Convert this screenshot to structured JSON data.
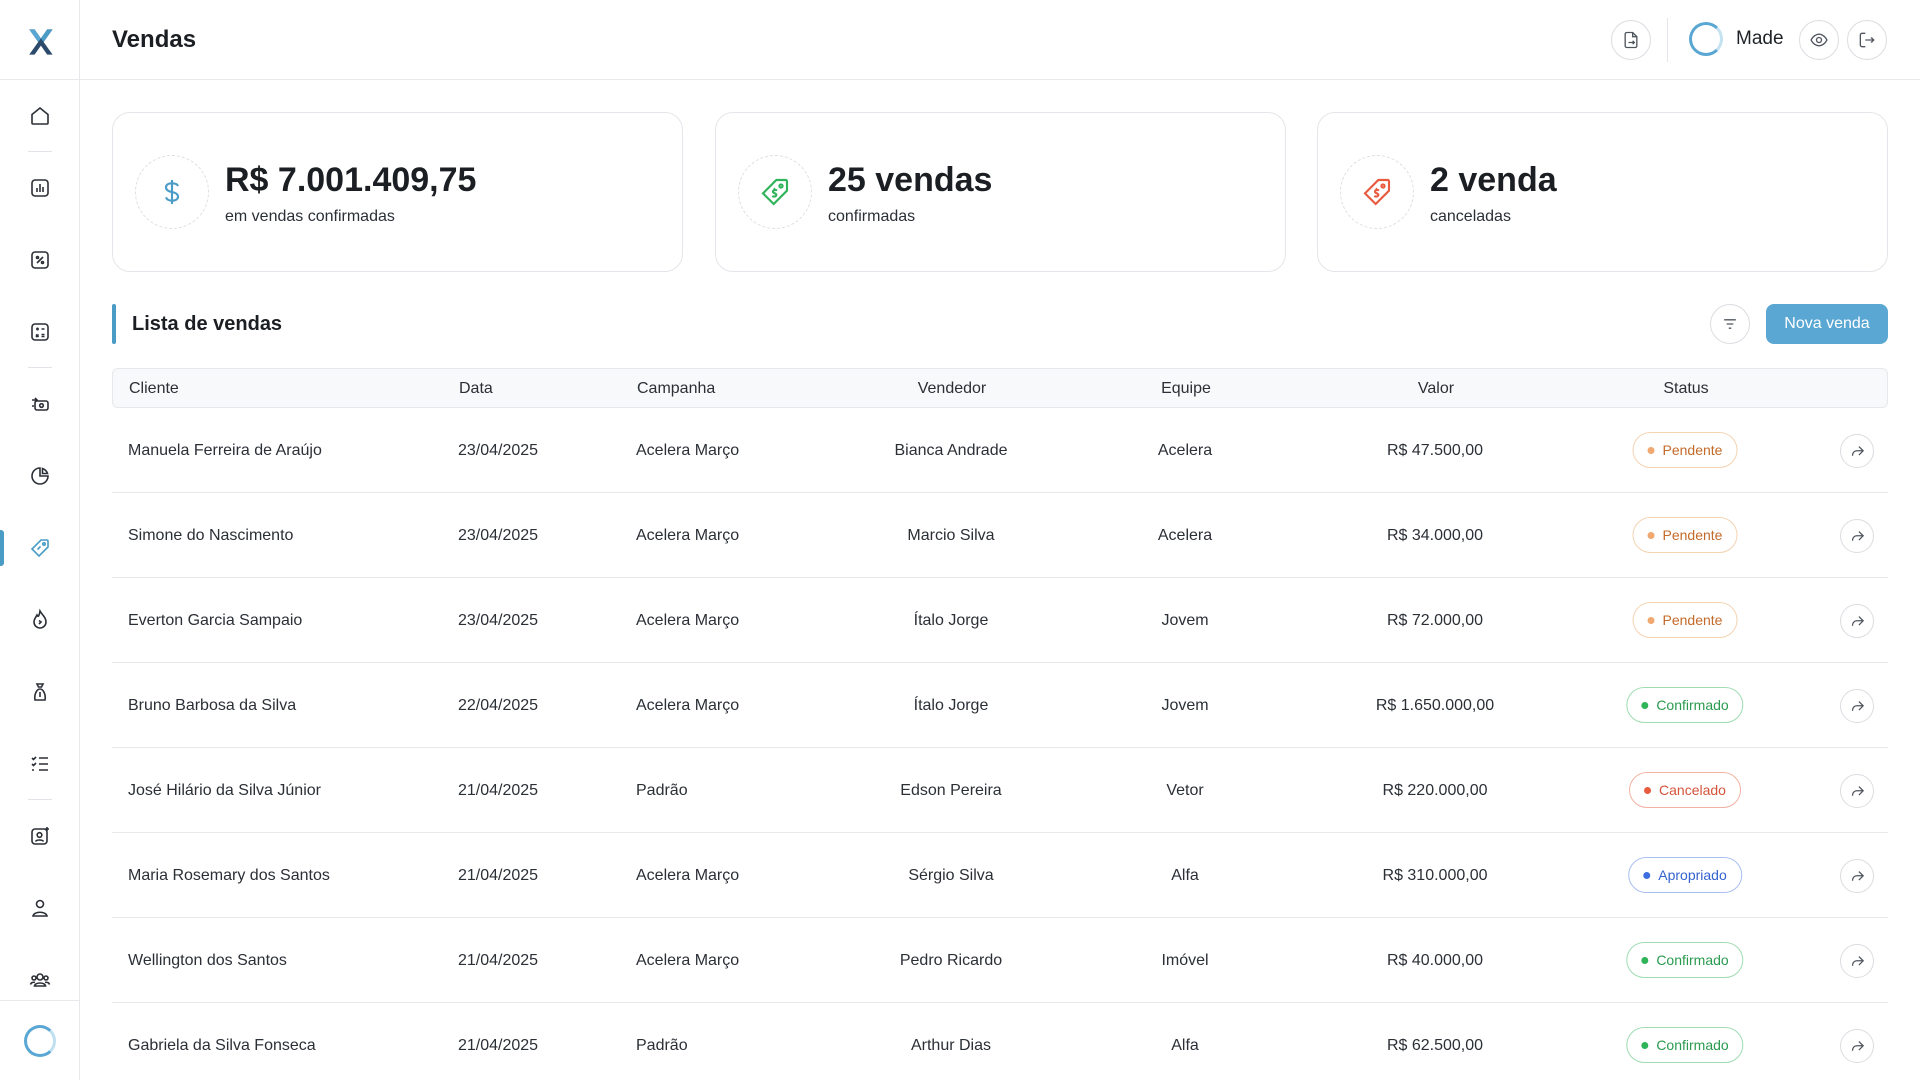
{
  "app": {
    "brand_color": "#4a9cc7",
    "logo_icon": "x-logo-icon"
  },
  "header": {
    "title": "Vendas",
    "user_name": "Made",
    "actions": [
      "export-document-icon",
      "eye-icon",
      "logout-icon"
    ]
  },
  "sidebar": {
    "items": [
      {
        "icon": "home-icon",
        "active": false
      },
      {
        "icon": "bar-chart-icon",
        "active": false
      },
      {
        "icon": "percent-icon",
        "active": false
      },
      {
        "icon": "calculator-icon",
        "active": false
      },
      {
        "icon": "money-transfer-icon",
        "active": false
      },
      {
        "icon": "pie-chart-icon",
        "active": false
      },
      {
        "icon": "price-tag-icon",
        "active": true
      },
      {
        "icon": "fire-icon",
        "active": false
      },
      {
        "icon": "hand-money-icon",
        "active": false
      },
      {
        "icon": "checklist-icon",
        "active": false
      },
      {
        "icon": "user-settings-icon",
        "active": false
      },
      {
        "icon": "user-icon",
        "active": false
      },
      {
        "icon": "users-group-icon",
        "active": false
      }
    ]
  },
  "kpis": [
    {
      "value": "R$ 7.001.409,75",
      "label": "em vendas confirmadas",
      "icon": "dollar-icon",
      "color": "#4a9cc7"
    },
    {
      "value": "25 vendas",
      "label": "confirmadas",
      "icon": "tag-green-icon",
      "color": "#2fb45a"
    },
    {
      "value": "2 venda",
      "label": "canceladas",
      "icon": "tag-red-icon",
      "color": "#e85b3e"
    }
  ],
  "sales": {
    "title": "Lista de vendas",
    "new_button": "Nova venda",
    "columns": {
      "cliente": "Cliente",
      "data": "Data",
      "campanha": "Campanha",
      "vendedor": "Vendedor",
      "equipe": "Equipe",
      "valor": "Valor",
      "status": "Status"
    },
    "rows": [
      {
        "cliente": "Manuela Ferreira de Araújo",
        "data": "23/04/2025",
        "campanha": "Acelera Março",
        "vendedor": "Bianca Andrade",
        "equipe": "Acelera",
        "valor": "R$ 47.500,00",
        "status": "Pendente",
        "status_type": "pending"
      },
      {
        "cliente": "Simone do Nascimento",
        "data": "23/04/2025",
        "campanha": "Acelera Março",
        "vendedor": "Marcio Silva",
        "equipe": "Acelera",
        "valor": "R$ 34.000,00",
        "status": "Pendente",
        "status_type": "pending"
      },
      {
        "cliente": "Everton Garcia Sampaio",
        "data": "23/04/2025",
        "campanha": "Acelera Março",
        "vendedor": "Ítalo Jorge",
        "equipe": "Jovem",
        "valor": "R$ 72.000,00",
        "status": "Pendente",
        "status_type": "pending"
      },
      {
        "cliente": "Bruno Barbosa da Silva",
        "data": "22/04/2025",
        "campanha": "Acelera Março",
        "vendedor": "Ítalo Jorge",
        "equipe": "Jovem",
        "valor": "R$ 1.650.000,00",
        "status": "Confirmado",
        "status_type": "confirmed"
      },
      {
        "cliente": "José Hilário da Silva Júnior",
        "data": "21/04/2025",
        "campanha": "Padrão",
        "vendedor": "Edson Pereira",
        "equipe": "Vetor",
        "valor": "R$ 220.000,00",
        "status": "Cancelado",
        "status_type": "canceled"
      },
      {
        "cliente": "Maria Rosemary dos Santos",
        "data": "21/04/2025",
        "campanha": "Acelera Março",
        "vendedor": "Sérgio Silva",
        "equipe": "Alfa",
        "valor": "R$ 310.000,00",
        "status": "Apropriado",
        "status_type": "appropriated"
      },
      {
        "cliente": "Wellington dos Santos",
        "data": "21/04/2025",
        "campanha": "Acelera Março",
        "vendedor": "Pedro Ricardo",
        "equipe": "Imóvel",
        "valor": "R$ 40.000,00",
        "status": "Confirmado",
        "status_type": "confirmed"
      },
      {
        "cliente": "Gabriela da Silva Fonseca",
        "data": "21/04/2025",
        "campanha": "Padrão",
        "vendedor": "Arthur Dias",
        "equipe": "Alfa",
        "valor": "R$ 62.500,00",
        "status": "Confirmado",
        "status_type": "confirmed"
      }
    ]
  }
}
